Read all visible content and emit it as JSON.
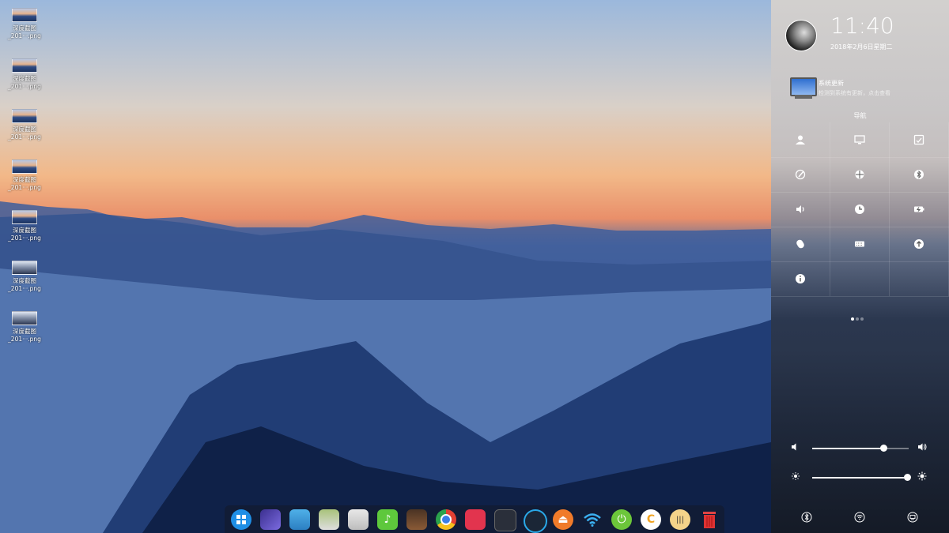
{
  "desktop": {
    "icons": [
      {
        "line1": "深度截图",
        "line2": "_201···.png"
      },
      {
        "line1": "深度截图",
        "line2": "_201···.png"
      },
      {
        "line1": "深度截图",
        "line2": "_201···.png"
      },
      {
        "line1": "深度截图",
        "line2": "_201···.png"
      },
      {
        "line1": "深度截图",
        "line2": "_201···.png"
      },
      {
        "line1": "深度截图",
        "line2": "_201···.png"
      },
      {
        "line1": "深度截图",
        "line2": "_201···.png"
      }
    ]
  },
  "panel": {
    "time": "11:40",
    "date": "2018年2月6日星期二",
    "notification": {
      "title": "系统更新",
      "desc": "检测到系统有更新，点击查看"
    },
    "nav_label": "导航",
    "volume_level": 0.74,
    "brightness_level": 0.98
  },
  "colors": {
    "panel_text": "#ffffff",
    "dock_bg": "rgba(20,25,40,.55)"
  }
}
